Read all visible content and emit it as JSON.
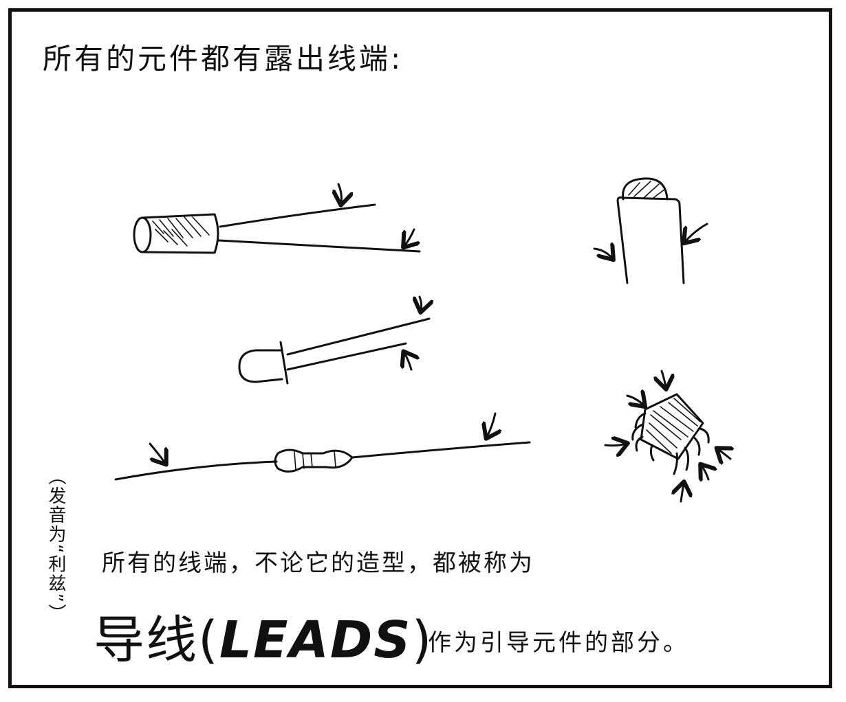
{
  "heading": "所有的元件都有露出线端:",
  "side_note": "（发音为“利兹”）",
  "caption": "所有的线端，不论它的造型，都被称为",
  "term": {
    "chinese": "导线(",
    "english": "LEADS",
    "close": ")"
  },
  "term_tail": "作为引导元件的部分。",
  "components": [
    {
      "name": "electrolytic-capacitor",
      "icon": "capacitor-sketch"
    },
    {
      "name": "led",
      "icon": "led-sketch"
    },
    {
      "name": "resistor",
      "icon": "resistor-sketch"
    },
    {
      "name": "single-lead-component",
      "icon": "post-sketch"
    },
    {
      "name": "integrated-circuit-chip",
      "icon": "ic-chip-sketch"
    }
  ]
}
